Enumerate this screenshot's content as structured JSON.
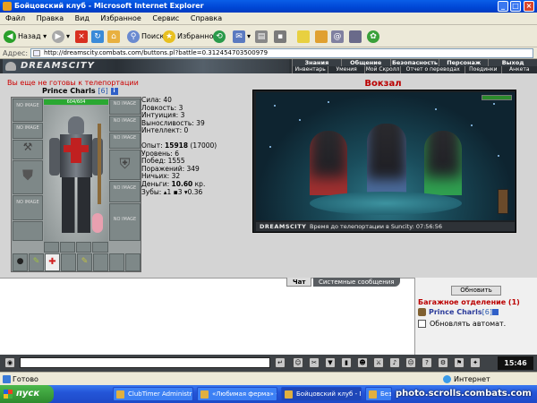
{
  "window": {
    "title": "Бойцовский клуб - Microsoft Internet Explorer"
  },
  "menu": [
    "Файл",
    "Правка",
    "Вид",
    "Избранное",
    "Сервис",
    "Справка"
  ],
  "toolbar": {
    "back": "Назад",
    "search": "Поиск",
    "favorites": "Избранное"
  },
  "address": {
    "label": "Адрес:",
    "url": "http://dreamscity.combats.com/buttons.pl?battle=0.312454703500979"
  },
  "game_header": {
    "logo": "DREAMSCITY",
    "nav_top": [
      "Знания",
      "Общение",
      "Безопасность",
      "Персонаж",
      "Выход"
    ],
    "nav_bottom": [
      "Инвентарь",
      "Умения",
      "Мой Скролл",
      "Отчет о переводах",
      "Поединки",
      "Анкета"
    ]
  },
  "character": {
    "warning": "Вы еще не готовы к телепортации",
    "name": "Prince Charls",
    "level": "[6]",
    "info": "i",
    "hp": "604/604",
    "empty_slot": "NO IMAGE",
    "stats": {
      "strength": "Сила: 40",
      "agility": "Ловкость: 3",
      "intuition": "Интуиция: 3",
      "endurance": "Выносливость: 39",
      "intellect": "Интеллект: 0",
      "exp_label": "Опыт:",
      "exp_value": "15918",
      "exp_next": "(17000)",
      "level": "Уровень: 6",
      "wins": "Побед: 1555",
      "losses": "Поражений: 349",
      "draws": "Ничьих: 32",
      "money_label": "Деньги:",
      "money_value": "10.60",
      "money_unit": "кр.",
      "teeth": "Зубы: ▴1 ▪3 ▾0.36"
    }
  },
  "location": {
    "title": "Вокзал",
    "brand": "DREAMSCITY",
    "teleport": "Время до телепортации в Suncity: 07:56:56"
  },
  "chat": {
    "tab_chat": "Чат",
    "tab_system": "Системные сообщения"
  },
  "side": {
    "refresh": "Обновить",
    "bag_title": "Багажное отделение (1)",
    "bag_char_name": "Prince Charls",
    "bag_char_level": "[6]",
    "auto_refresh": "Обновлять автомат."
  },
  "clock": "15:46",
  "status": {
    "done": "Готово",
    "zone": "Интернет"
  },
  "taskbar": {
    "start": "пуск",
    "tasks": [
      "ClubTimer Administrat...",
      "«Любимая ферма» - ...",
      "Бойцовский клуб - M...",
      "Безымянны..."
    ]
  },
  "watermark": "photo.scrolls.combats.com"
}
